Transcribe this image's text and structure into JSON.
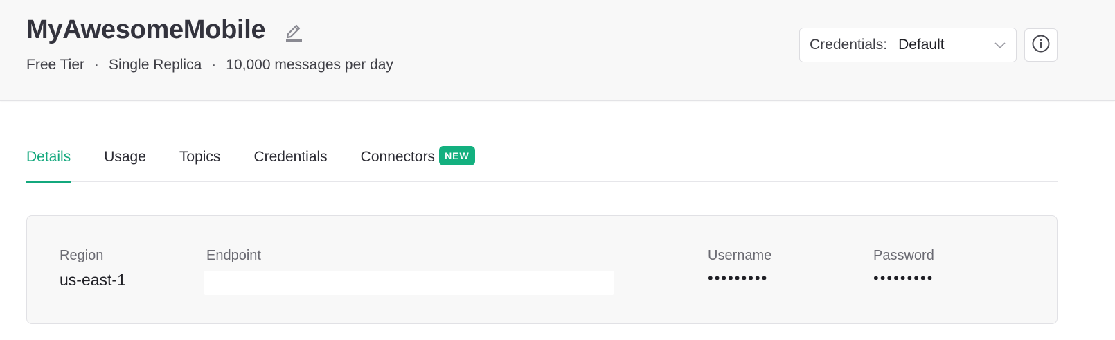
{
  "header": {
    "title": "MyAwesomeMobile",
    "subtitle": {
      "tier": "Free Tier",
      "separator": "·",
      "replica": "Single Replica",
      "quota": "10,000 messages per day"
    },
    "credentials": {
      "label": "Credentials:",
      "value": "Default"
    }
  },
  "icons": {
    "edit": "pencil-icon",
    "dropdown": "chevron-down-icon",
    "info": "info-icon"
  },
  "tabs": [
    {
      "label": "Details",
      "active": true
    },
    {
      "label": "Usage",
      "active": false
    },
    {
      "label": "Topics",
      "active": false
    },
    {
      "label": "Credentials",
      "active": false
    },
    {
      "label": "Connectors",
      "active": false,
      "badge": "NEW"
    }
  ],
  "details": {
    "region": {
      "label": "Region",
      "value": "us-east-1"
    },
    "endpoint": {
      "label": "Endpoint",
      "value": ""
    },
    "username": {
      "label": "Username",
      "value": "•••••••••"
    },
    "password": {
      "label": "Password",
      "value": "•••••••••"
    }
  },
  "colors": {
    "accent": "#13a87d",
    "badge": "#13b07f",
    "header_bg": "#f8f8f8"
  }
}
